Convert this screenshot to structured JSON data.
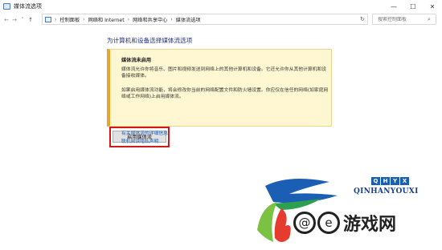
{
  "window": {
    "title": "媒体流选项",
    "buttons": {
      "minimize": "—",
      "maximize": "☐",
      "close": "✕"
    }
  },
  "addressbar": {
    "back": "←",
    "forward": "→",
    "dropdown": "˅",
    "up": "↑",
    "breadcrumbs": [
      "控制面板",
      "网络和 Internet",
      "网络和共享中心",
      "媒体流选项"
    ],
    "separator": "›",
    "refresh": "↻"
  },
  "search": {
    "placeholder": "搜索控制面板",
    "icon": "search-icon"
  },
  "main": {
    "title": "为计算机和设备选择媒体流选项",
    "notice": {
      "heading": "媒体流未启用",
      "paragraph1": "媒体流允许你将音乐、图片和视频发送到网络上的其他计算机和设备。它还允许你从其他计算机和设备接收媒体。",
      "paragraph2": "如果启用媒体流功能，将会修改你当前的网络配置文件和防火墙设置。你应仅在信任的网络(如家庭网络或工作网络)上启用媒体流。"
    },
    "enable_button": "启用媒体流",
    "links": [
      "有关媒体流的详细信息",
      "联机阅读隐私声明"
    ]
  },
  "watermark": {
    "badge": [
      "Q",
      "H",
      "Y",
      "X"
    ],
    "brand": "QINHANYOUXI",
    "site_circles": [
      "@",
      "e"
    ],
    "site_chars": "游戏网"
  },
  "colors": {
    "title_blue": "#1e3287",
    "link_blue": "#1a5fb4",
    "notice_bg": "#fff7d1",
    "notice_accent": "#e9a52b",
    "highlight_red": "#d01818"
  }
}
